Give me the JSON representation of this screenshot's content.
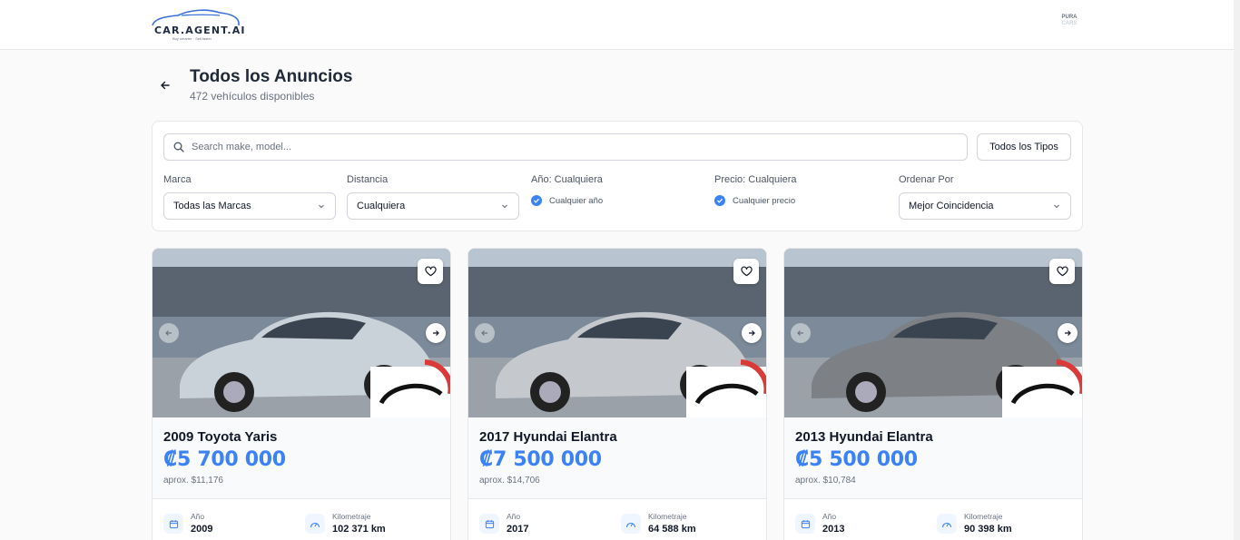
{
  "header": {
    "logo_text": "CAR.AGENT.AI",
    "logo_tagline": "Buy smarter · Sell faster",
    "partner_logo_top": "PURA",
    "partner_logo_bottom": "CARS"
  },
  "page": {
    "title": "Todos los Anuncios",
    "subtitle": "472 vehículos disponibles"
  },
  "filters": {
    "search_placeholder": "Search make, model...",
    "types_button": "Todos los Tipos",
    "brand": {
      "label": "Marca",
      "value": "Todas las Marcas"
    },
    "distance": {
      "label": "Distancia",
      "value": "Cualquiera"
    },
    "year": {
      "label": "Año: Cualquiera",
      "option": "Cualquier año"
    },
    "price": {
      "label": "Precio: Cualquiera",
      "option": "Cualquier precio"
    },
    "sort": {
      "label": "Ordenar Por",
      "value": "Mejor Coincidencia"
    }
  },
  "spec_labels": {
    "year": "Año",
    "mileage": "Kilometraje"
  },
  "listings": [
    {
      "title": "2009 Toyota Yaris",
      "price": "₡5 700 000",
      "approx": "aprox. $11,176",
      "year": "2009",
      "mileage": "102 371 km",
      "car_color": "#c9d1d9"
    },
    {
      "title": "2017 Hyundai Elantra",
      "price": "₡7 500 000",
      "approx": "aprox. $14,706",
      "year": "2017",
      "mileage": "64 588 km",
      "car_color": "#c5c9ce"
    },
    {
      "title": "2013 Hyundai Elantra",
      "price": "₡5 500 000",
      "approx": "aprox. $10,784",
      "year": "2013",
      "mileage": "90 398 km",
      "car_color": "#7d8085"
    }
  ],
  "colors": {
    "accent": "#3b82f6",
    "border": "#e5e7eb"
  }
}
